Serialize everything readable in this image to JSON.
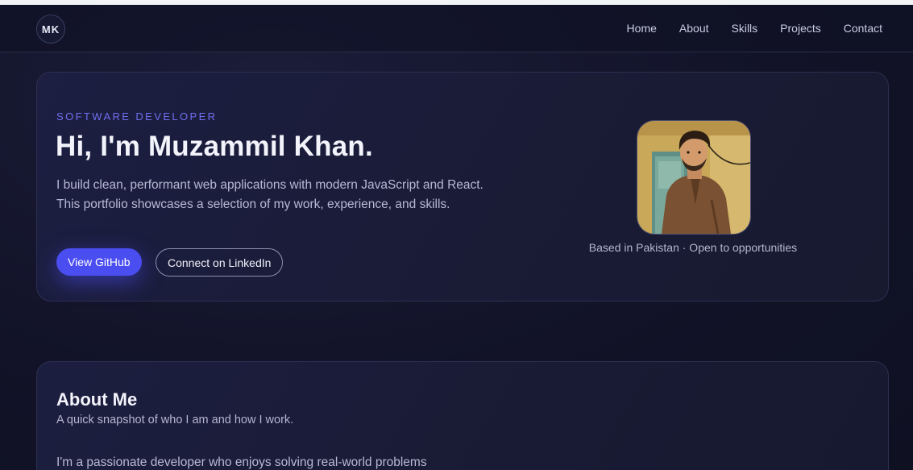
{
  "nav": {
    "logo_text": "MK",
    "links": [
      "Home",
      "About",
      "Skills",
      "Projects",
      "Contact"
    ]
  },
  "hero": {
    "eyebrow": "SOFTWARE DEVELOPER",
    "title": "Hi, I'm Muzammil Khan.",
    "description": "I build clean, performant web applications with modern JavaScript and React. This portfolio showcases a selection of my work, experience, and skills.",
    "primary_button": "View GitHub",
    "secondary_button": "Connect on LinkedIn",
    "caption": "Based in Pakistan · Open to opportunities"
  },
  "about": {
    "title": "About Me",
    "subtitle": "A quick snapshot of who I am and how I work.",
    "body": "I'm a passionate developer who enjoys solving real-world problems"
  },
  "colors": {
    "accent": "#4a4df0",
    "eyebrow": "#6f6ff0",
    "background": "#12142a"
  }
}
